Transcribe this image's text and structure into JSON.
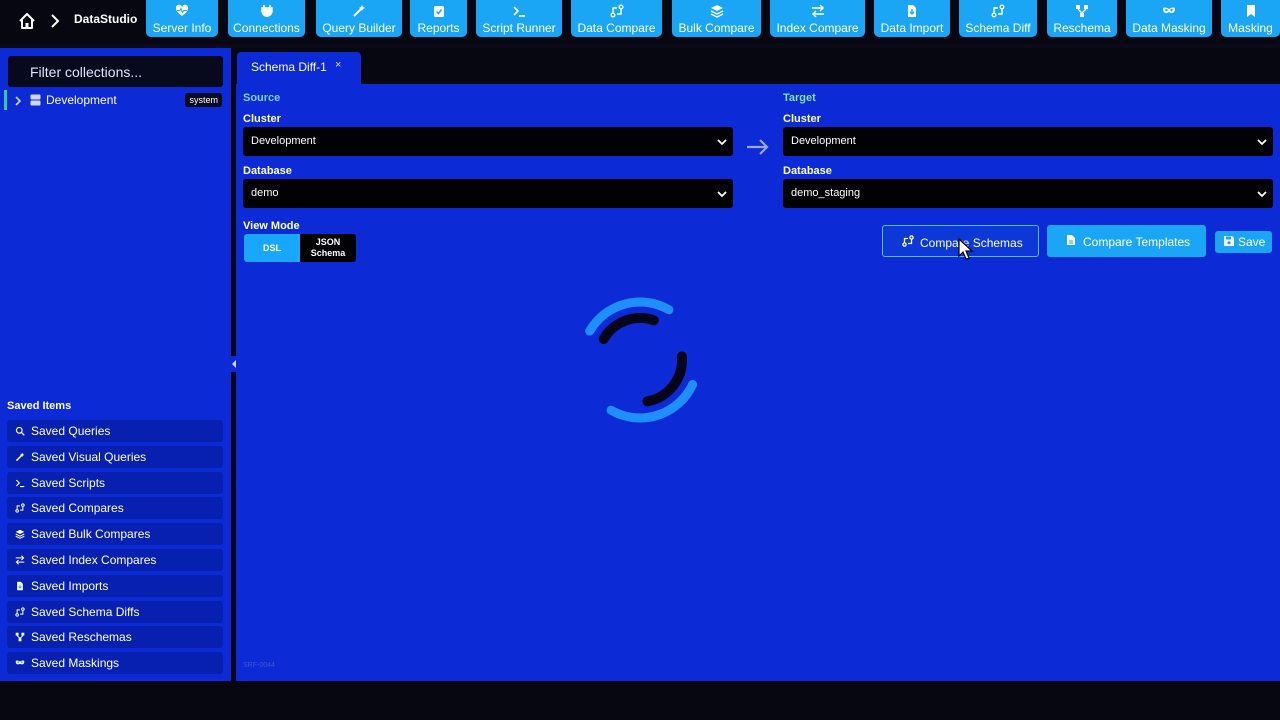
{
  "app": {
    "name": "DataStudio"
  },
  "toolbar": {
    "items": [
      {
        "label": "Server Info",
        "icon": "heart-pulse-icon"
      },
      {
        "label": "Connections",
        "icon": "plug-icon"
      },
      {
        "label": "Query Builder",
        "icon": "magic-wand-icon"
      },
      {
        "label": "Reports",
        "icon": "clipboard-check-icon"
      },
      {
        "label": "Script Runner",
        "icon": "terminal-icon"
      },
      {
        "label": "Data Compare",
        "icon": "git-compare-icon"
      },
      {
        "label": "Bulk Compare",
        "icon": "layers-icon"
      },
      {
        "label": "Index Compare",
        "icon": "arrows-exchange-icon"
      },
      {
        "label": "Data Import",
        "icon": "file-import-icon"
      },
      {
        "label": "Schema Diff",
        "icon": "git-compare-icon"
      },
      {
        "label": "Reschema",
        "icon": "sitemap-icon"
      },
      {
        "label": "Data Masking",
        "icon": "mask-icon"
      },
      {
        "label": "Masking",
        "icon": "bookmark-icon"
      }
    ]
  },
  "sidebar": {
    "filter_placeholder": "Filter collections...",
    "tree": [
      {
        "label": "Development",
        "badge": "system"
      }
    ],
    "saved_title": "Saved Items",
    "saved_items": [
      {
        "label": "Saved Queries",
        "icon": "search-icon"
      },
      {
        "label": "Saved Visual Queries",
        "icon": "magic-wand-icon"
      },
      {
        "label": "Saved Scripts",
        "icon": "terminal-icon"
      },
      {
        "label": "Saved Compares",
        "icon": "git-compare-icon"
      },
      {
        "label": "Saved Bulk Compares",
        "icon": "layers-icon"
      },
      {
        "label": "Saved Index Compares",
        "icon": "arrows-exchange-icon"
      },
      {
        "label": "Saved Imports",
        "icon": "file-import-icon"
      },
      {
        "label": "Saved Schema Diffs",
        "icon": "git-compare-icon"
      },
      {
        "label": "Saved Reschemas",
        "icon": "sitemap-icon"
      },
      {
        "label": "Saved Maskings",
        "icon": "mask-icon"
      }
    ]
  },
  "tabs": [
    {
      "label": "Schema Diff-1",
      "close": "×"
    }
  ],
  "source": {
    "heading": "Source",
    "cluster_label": "Cluster",
    "cluster_value": "Development",
    "database_label": "Database",
    "database_value": "demo"
  },
  "target": {
    "heading": "Target",
    "cluster_label": "Cluster",
    "cluster_value": "Development",
    "database_label": "Database",
    "database_value": "demo_staging"
  },
  "view_mode": {
    "label": "View Mode",
    "options": [
      "DSL",
      "JSON Schema"
    ],
    "selected": "DSL"
  },
  "actions": {
    "compare_schemas": "Compare Schemas",
    "compare_templates": "Compare Templates",
    "save": "Save"
  },
  "status": {
    "loading": true
  },
  "footer": {
    "id": "SRF-0044"
  },
  "colors": {
    "accent": "#1aa6f5",
    "panel": "#0c2ad6",
    "dark": "#070712",
    "source_heading": "#7fd0ff",
    "target_heading": "#7be3b3"
  }
}
